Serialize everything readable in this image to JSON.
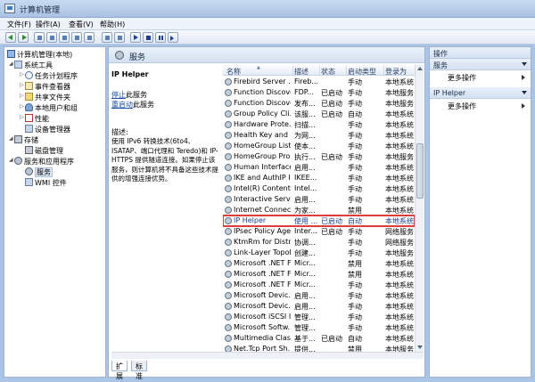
{
  "window": {
    "title": "计算机管理"
  },
  "menu": [
    "文件(F)",
    "操作(A)",
    "查看(V)",
    "帮助(H)"
  ],
  "tree": {
    "root": "计算机管理(本地)",
    "system_tools": "系统工具",
    "task_scheduler": "任务计划程序",
    "event_viewer": "事件查看器",
    "shared_folders": "共享文件夹",
    "local_users": "本地用户和组",
    "performance": "性能",
    "device_manager": "设备管理器",
    "storage": "存储",
    "disk_management": "磁盘管理",
    "services_apps": "服务和应用程序",
    "services": "服务",
    "wmi": "WMI 控件"
  },
  "center": {
    "header": "服务",
    "selected_service": "IP Helper",
    "stop_link": "停止",
    "stop_suffix": "此服务",
    "restart_link": "重启动",
    "restart_suffix": "此服务",
    "desc_label": "描述:",
    "description": "使用 IPv6 转换技术(6to4、ISATAP、端口代理和 Teredo)和 IP-HTTPS 提供隧道连接。如果停止该服务，则计算机将不具备这些技术提供的增强连接优势。"
  },
  "columns": {
    "name": "名称",
    "desc": "描述",
    "state": "状态",
    "start": "启动类型",
    "logon": "登录为"
  },
  "services": [
    {
      "name": "Firebird Server ...",
      "desc": "Fireb...",
      "state": "",
      "start": "手动",
      "logon": "本地系统"
    },
    {
      "name": "Function Discove...",
      "desc": "FDP...",
      "state": "已启动",
      "start": "手动",
      "logon": "本地服务"
    },
    {
      "name": "Function Discove...",
      "desc": "发布...",
      "state": "已启动",
      "start": "手动",
      "logon": "本地服务"
    },
    {
      "name": "Group Policy Cli...",
      "desc": "该服...",
      "state": "已启动",
      "start": "自动",
      "logon": "本地系统"
    },
    {
      "name": "Hardware Prote...",
      "desc": "扫描...",
      "state": "",
      "start": "手动",
      "logon": "本地系统"
    },
    {
      "name": "Health Key and ...",
      "desc": "为网...",
      "state": "",
      "start": "手动",
      "logon": "本地系统"
    },
    {
      "name": "HomeGroup List...",
      "desc": "使本...",
      "state": "",
      "start": "手动",
      "logon": "本地系统"
    },
    {
      "name": "HomeGroup Pro...",
      "desc": "执行...",
      "state": "已启动",
      "start": "手动",
      "logon": "本地服务"
    },
    {
      "name": "Human Interface...",
      "desc": "启用...",
      "state": "",
      "start": "手动",
      "logon": "本地系统"
    },
    {
      "name": "IKE and AuthIP I...",
      "desc": "IKEE...",
      "state": "",
      "start": "手动",
      "logon": "本地系统"
    },
    {
      "name": "Intel(R) Content ...",
      "desc": "Intel...",
      "state": "",
      "start": "手动",
      "logon": "本地系统"
    },
    {
      "name": "Interactive Servi...",
      "desc": "启用...",
      "state": "",
      "start": "手动",
      "logon": "本地系统"
    },
    {
      "name": "Internet Connect...",
      "desc": "为家...",
      "state": "",
      "start": "禁用",
      "logon": "本地系统"
    },
    {
      "name": "IP Helper",
      "desc": "使用 ...",
      "state": "已启动",
      "start": "自动",
      "logon": "本地系统"
    },
    {
      "name": "IPsec Policy Agent",
      "desc": "Inter...",
      "state": "已启动",
      "start": "手动",
      "logon": "网络服务"
    },
    {
      "name": "KtmRm for Distri...",
      "desc": "协调...",
      "state": "",
      "start": "手动",
      "logon": "网络服务"
    },
    {
      "name": "Link-Layer Topol...",
      "desc": "创建...",
      "state": "",
      "start": "手动",
      "logon": "本地服务"
    },
    {
      "name": "Microsoft .NET F...",
      "desc": "Micr...",
      "state": "",
      "start": "禁用",
      "logon": "本地系统"
    },
    {
      "name": "Microsoft .NET F...",
      "desc": "Micr...",
      "state": "",
      "start": "禁用",
      "logon": "本地系统"
    },
    {
      "name": "Microsoft .NET F...",
      "desc": "Micr...",
      "state": "",
      "start": "手动",
      "logon": "本地系统"
    },
    {
      "name": "Microsoft Devic...",
      "desc": "启用...",
      "state": "",
      "start": "手动",
      "logon": "本地系统"
    },
    {
      "name": "Microsoft Devic...",
      "desc": "启用...",
      "state": "",
      "start": "手动",
      "logon": "本地系统"
    },
    {
      "name": "Microsoft iSCSI I...",
      "desc": "管理...",
      "state": "",
      "start": "手动",
      "logon": "本地系统"
    },
    {
      "name": "Microsoft Softw...",
      "desc": "管理...",
      "state": "",
      "start": "手动",
      "logon": "本地系统"
    },
    {
      "name": "Multimedia Clas...",
      "desc": "基于...",
      "state": "已启动",
      "start": "自动",
      "logon": "本地系统"
    },
    {
      "name": "Net.Tcp Port Sh...",
      "desc": "提供...",
      "state": "",
      "start": "禁用",
      "logon": "本地服务"
    }
  ],
  "tabs": [
    "扩展",
    "标准"
  ],
  "actions": {
    "title": "操作",
    "section1": "服务",
    "more1": "更多操作",
    "section2": "IP Helper",
    "more2": "更多操作"
  }
}
